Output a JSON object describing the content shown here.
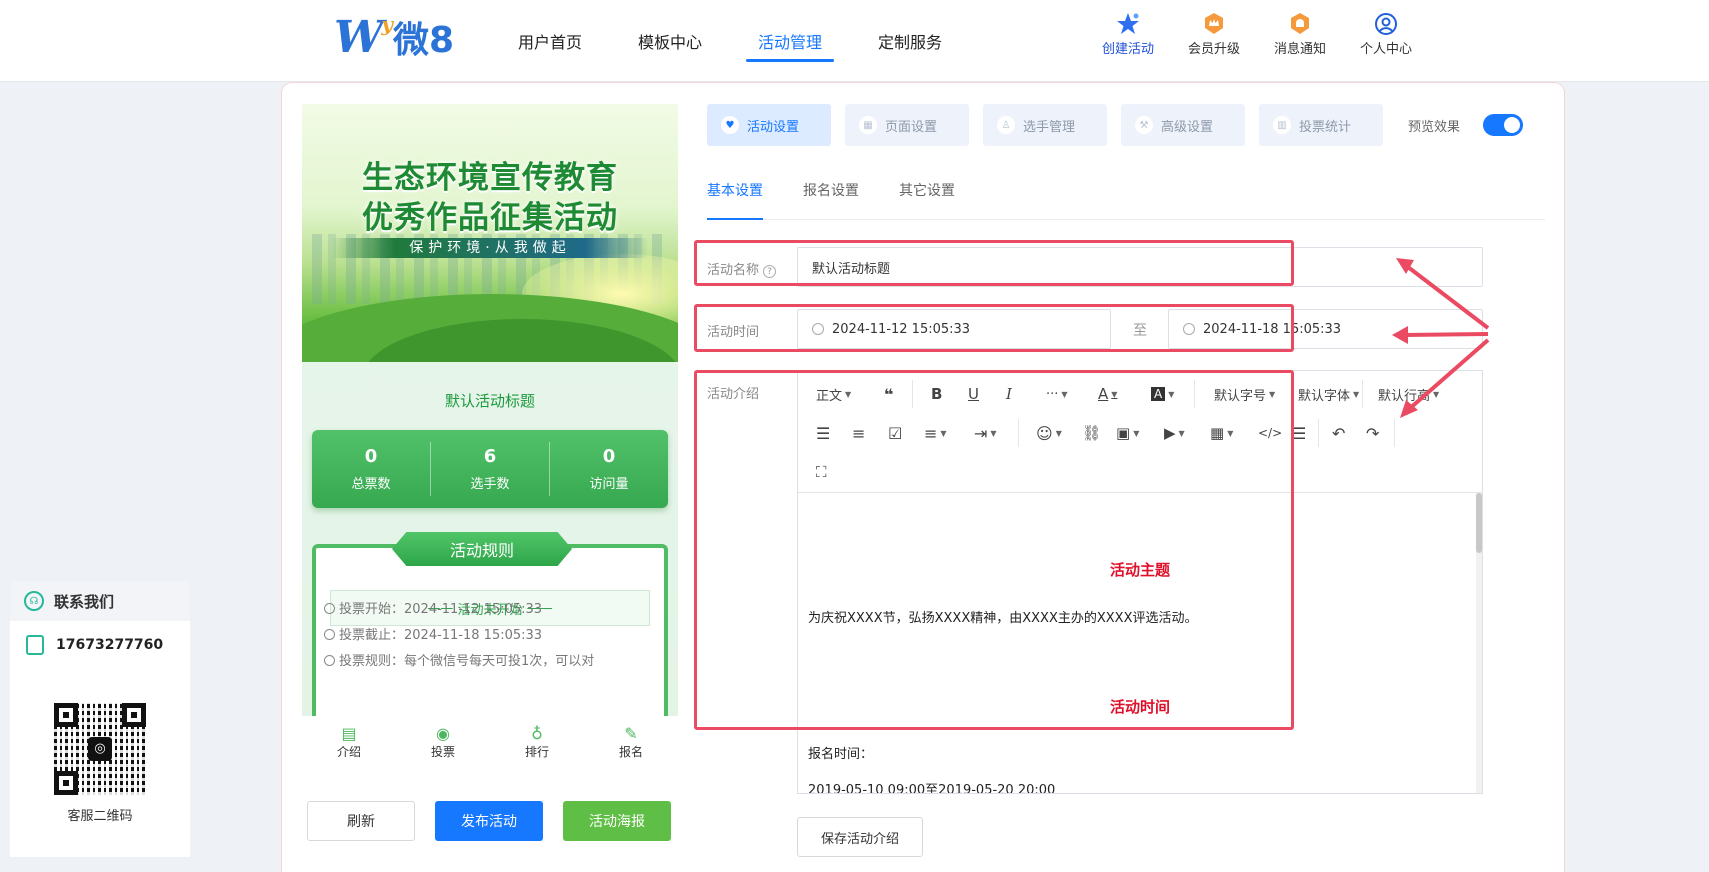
{
  "header": {
    "logo_brand": "W",
    "logo_name": "微8",
    "nav": [
      {
        "label": "用户首页"
      },
      {
        "label": "模板中心"
      },
      {
        "label": "活动管理"
      },
      {
        "label": "定制服务"
      }
    ],
    "tools": [
      {
        "label": "创建活动",
        "icon": "star-icon"
      },
      {
        "label": "会员升级",
        "icon": "crown-badge-icon"
      },
      {
        "label": "消息通知",
        "icon": "bell-badge-icon"
      },
      {
        "label": "个人中心",
        "icon": "user-circle-icon"
      }
    ]
  },
  "preview": {
    "banner_title_1": "生态环境宣传教育",
    "banner_title_2": "优秀作品征集活动",
    "banner_sub": "保护环境·从我做起",
    "activity_title": "默认活动标题",
    "stats": [
      {
        "value": "0",
        "label": "总票数"
      },
      {
        "value": "6",
        "label": "选手数"
      },
      {
        "value": "0",
        "label": "访问量"
      }
    ],
    "rules_heading": "活动规则",
    "rules_status": "活动未开始",
    "rule_lines": [
      "投票开始：2024-11-12 15:05:33",
      "投票截止：2024-11-18 15:05:33",
      "投票规则：每个微信号每天可投1次，可以对"
    ],
    "tabs": [
      {
        "label": "介绍",
        "icon": "document-icon"
      },
      {
        "label": "投票",
        "icon": "vote-icon"
      },
      {
        "label": "排行",
        "icon": "medal-icon"
      },
      {
        "label": "报名",
        "icon": "edit-icon"
      }
    ],
    "buttons": {
      "refresh": "刷新",
      "publish": "发布活动",
      "poster": "活动海报"
    }
  },
  "settings": {
    "tabs": [
      {
        "label": "活动设置",
        "icon": "heart-icon"
      },
      {
        "label": "页面设置",
        "icon": "page-icon"
      },
      {
        "label": "选手管理",
        "icon": "person-icon"
      },
      {
        "label": "高级设置",
        "icon": "tools-icon"
      },
      {
        "label": "投票统计",
        "icon": "chart-icon"
      }
    ],
    "preview_label": "预览效果",
    "preview_on": true,
    "subtabs": [
      "基本设置",
      "报名设置",
      "其它设置"
    ],
    "name_label": "活动名称",
    "name_value": "默认活动标题",
    "time_label": "活动时间",
    "time_start": "2024-11-12 15:05:33",
    "time_to": "至",
    "time_end": "2024-11-18 15:05:33",
    "intro_label": "活动介绍",
    "toolbar": {
      "paragraph": "正文",
      "font_size": "默认字号",
      "font_family": "默认字体",
      "line_height": "默认行高"
    },
    "content": {
      "heading_1": "活动主题",
      "paragraph_1": "为庆祝XXXX节，弘扬XXXX精神，由XXXX主办的XXXX评选活动。",
      "heading_2": "活动时间",
      "paragraph_2": "报名时间：",
      "paragraph_3": "2019-05-10 09:00至2019-05-20 20:00"
    },
    "save_intro": "保存活动介绍"
  },
  "contact": {
    "title": "联系我们",
    "phone": "17673277760",
    "qr_label": "客服二维码"
  },
  "colors": {
    "primary": "#1677ff",
    "green": "#5fbe45",
    "annotation_red": "#ea4b62"
  }
}
